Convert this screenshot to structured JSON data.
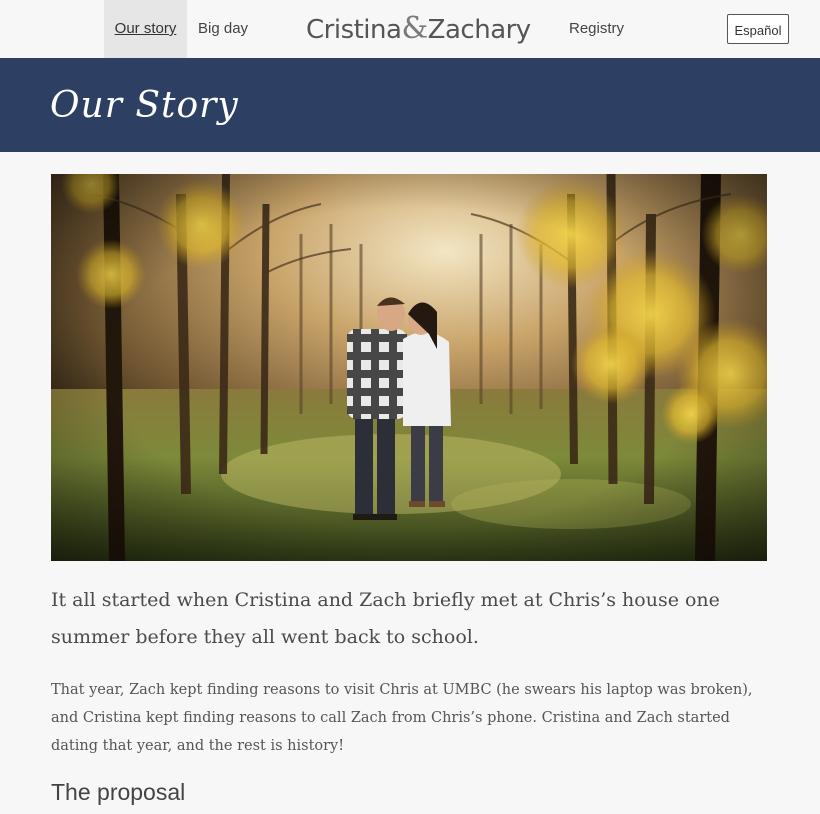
{
  "nav": {
    "our_story": "Our story",
    "big_day": "Big day",
    "registry": "Registry",
    "brand_first": "Cristina",
    "brand_amp": "&",
    "brand_second": "Zachary",
    "language_button": "Español"
  },
  "hero": {
    "title": "Our Story"
  },
  "photo": {
    "description_icon": "engagement-photo"
  },
  "content": {
    "lead": "It all started when Cristina and Zach briefly met at Chris’s house one summer before they all went back to school.",
    "paragraph": "That year, Zach kept finding reasons to visit Chris at UMBC (he swears his laptop was broken), and Cristina kept finding reasons to call Zach from Chris’s phone. Cristina and Zach started dating that year, and the rest is history!",
    "proposal_heading": "The proposal"
  },
  "colors": {
    "header_band": "#2e3f64",
    "page_background": "#f7f7f7",
    "active_nav": "#e6e6e6"
  }
}
